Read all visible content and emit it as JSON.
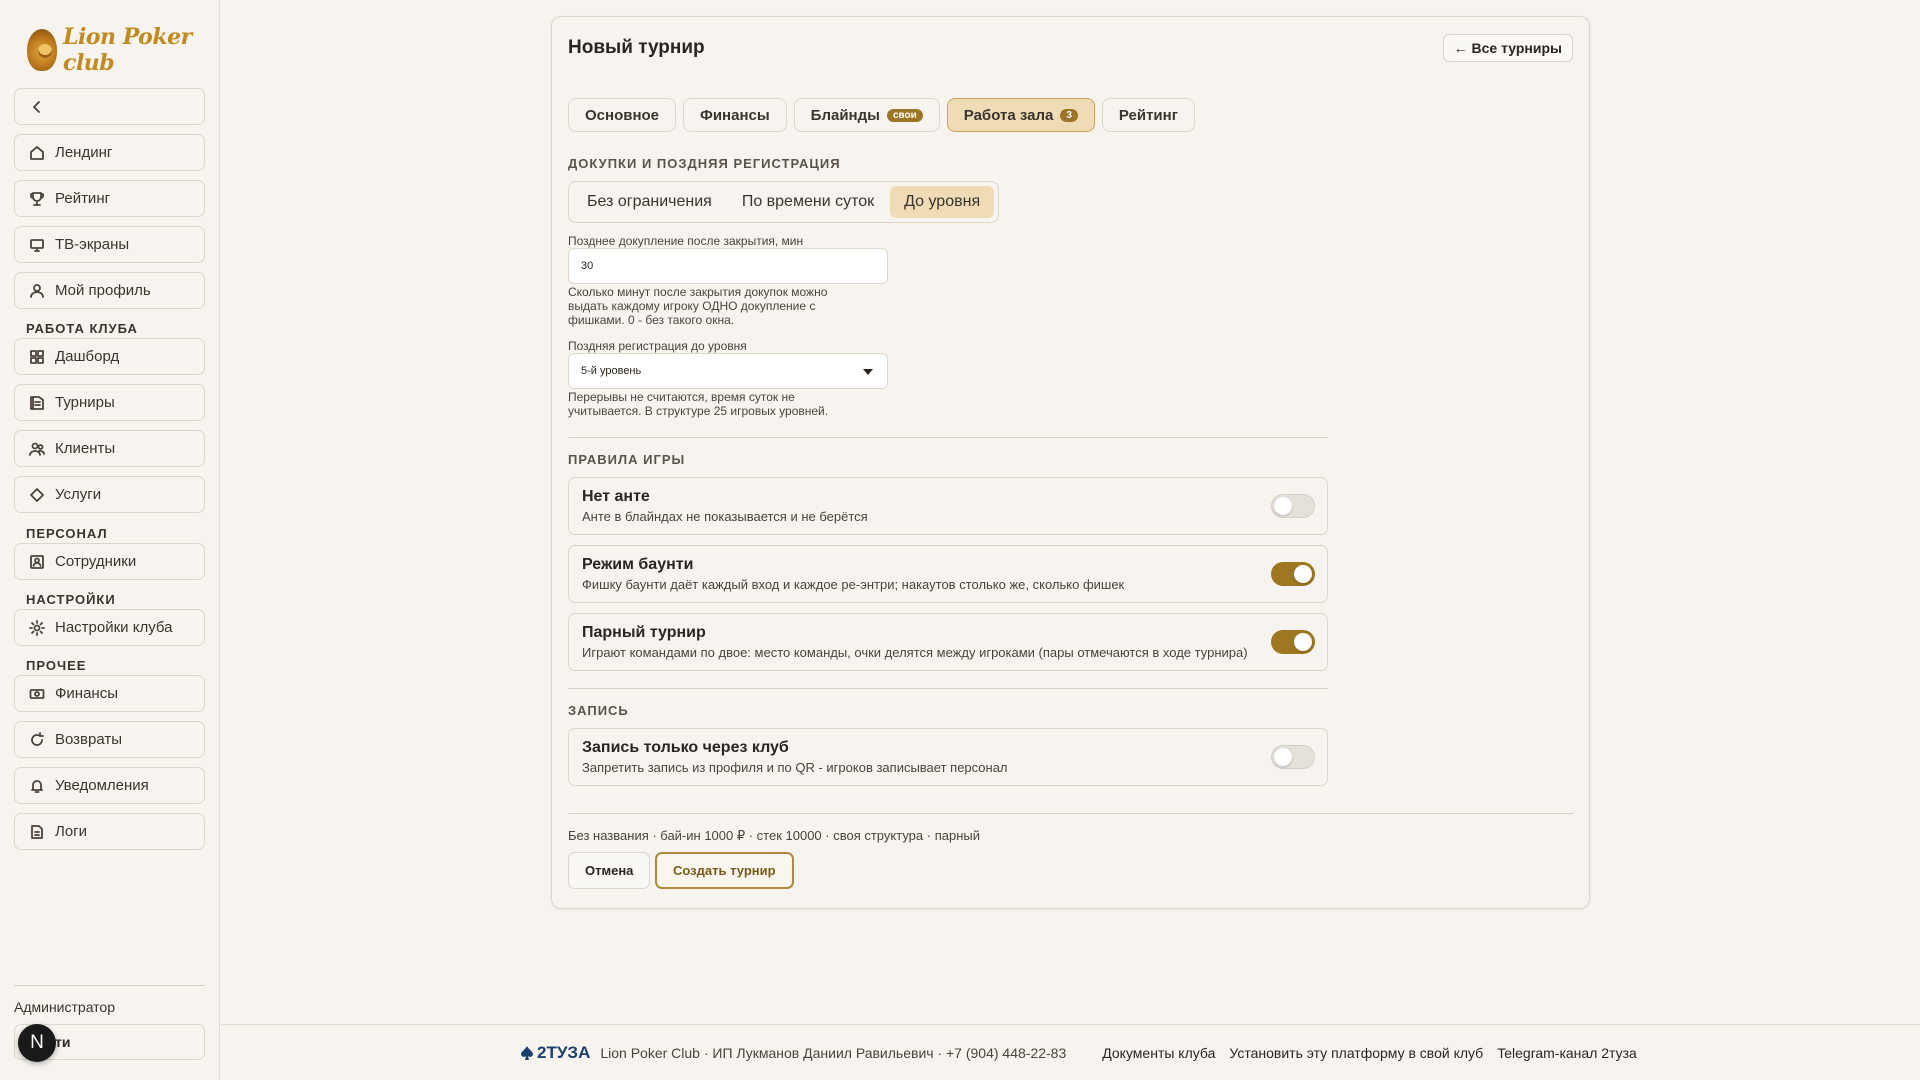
{
  "brand": {
    "logo_text": "Lion Poker club"
  },
  "sidebar": {
    "collapse_icon": "chevron-left-icon",
    "main_items": [
      {
        "label": "Лендинг",
        "icon": "home-icon"
      },
      {
        "label": "Рейтинг",
        "icon": "trophy-icon"
      },
      {
        "label": "ТВ-экраны",
        "icon": "monitor-icon"
      },
      {
        "label": "Мой профиль",
        "icon": "user-icon"
      }
    ],
    "section_club": "РАБОТА КЛУБА",
    "club_items": [
      {
        "label": "Дашборд",
        "icon": "grid-icon"
      },
      {
        "label": "Турниры",
        "icon": "calendar-icon"
      },
      {
        "label": "Клиенты",
        "icon": "users-icon"
      },
      {
        "label": "Услуги",
        "icon": "diamond-icon"
      }
    ],
    "section_staff": "ПЕРСОНАЛ",
    "staff_items": [
      {
        "label": "Сотрудники",
        "icon": "id-card-icon"
      }
    ],
    "section_settings": "НАСТРОЙКИ",
    "settings_items": [
      {
        "label": "Настройки клуба",
        "icon": "gear-icon"
      }
    ],
    "section_other": "ПРОЧЕЕ",
    "other_items": [
      {
        "label": "Финансы",
        "icon": "cash-icon"
      },
      {
        "label": "Возвраты",
        "icon": "refresh-icon"
      },
      {
        "label": "Уведомления",
        "icon": "bell-icon"
      },
      {
        "label": "Логи",
        "icon": "file-icon"
      }
    ],
    "user_role": "Администратор",
    "logout_label": "ти",
    "avatar_letter": "N"
  },
  "card": {
    "title": "Новый турнир",
    "back_label": "← Все турниры",
    "tabs": [
      {
        "label": "Основное",
        "badge": ""
      },
      {
        "label": "Финансы",
        "badge": ""
      },
      {
        "label": "Блайнды",
        "badge": "свои"
      },
      {
        "label": "Работа зала",
        "badge": "3",
        "active": true
      },
      {
        "label": "Рейтинг",
        "badge": ""
      }
    ],
    "rebuy_section": "ДОКУПКИ И ПОЗДНЯЯ РЕГИСТРАЦИЯ",
    "rebuy_modes": [
      "Без ограничения",
      "По времени суток",
      "До уровня"
    ],
    "rebuy_mode_selected": "До уровня",
    "late_rebuy_label": "Позднее докупление после закрытия, мин",
    "late_rebuy_value": "30",
    "late_rebuy_hint": "Сколько минут после закрытия докупок можно выдать каждому игроку ОДНО докупление с фишками. 0 - без такого окна.",
    "late_reg_label": "Поздняя регистрация до уровня",
    "late_reg_value": "5-й уровень",
    "late_reg_hint": "Перерывы не считаются, время суток не учитывается. В структуре 25 игровых уровней.",
    "rules_section": "ПРАВИЛА ИГРЫ",
    "rules": [
      {
        "title": "Нет анте",
        "desc": "Анте в блайндах не показывается и не берётся",
        "on": false
      },
      {
        "title": "Режим баунти",
        "desc": "Фишку баунти даёт каждый вход и каждое ре-энтри; накаутов столько же, сколько фишек",
        "on": true
      },
      {
        "title": "Парный турнир",
        "desc": "Играют командами по двое: место команды, очки делятся между игроками (пары отмечаются в ходе турнира)",
        "on": true
      }
    ],
    "signup_section": "ЗАПИСЬ",
    "signup_rules": [
      {
        "title": "Запись только через клуб",
        "desc": "Запретить запись из профиля и по QR - игроков записывает персонал",
        "on": false
      }
    ],
    "summary": "Без названия · бай-ин 1000 ₽ · стек 10000 · своя структура · парный",
    "cancel_label": "Отмена",
    "create_label": "Создать турнир"
  },
  "footer": {
    "brand": "2ТУЗА",
    "club": "Lion Poker Club · ИП Лукманов Даниил Равильевич · +7 (904) 448-22-83",
    "links": [
      "Документы клуба",
      "Установить эту платформу в свой клуб",
      "Telegram-канал 2туза"
    ]
  },
  "colors": {
    "accent": "#a07721",
    "accent_light": "#efdcb6",
    "background": "#f7f4ef"
  }
}
